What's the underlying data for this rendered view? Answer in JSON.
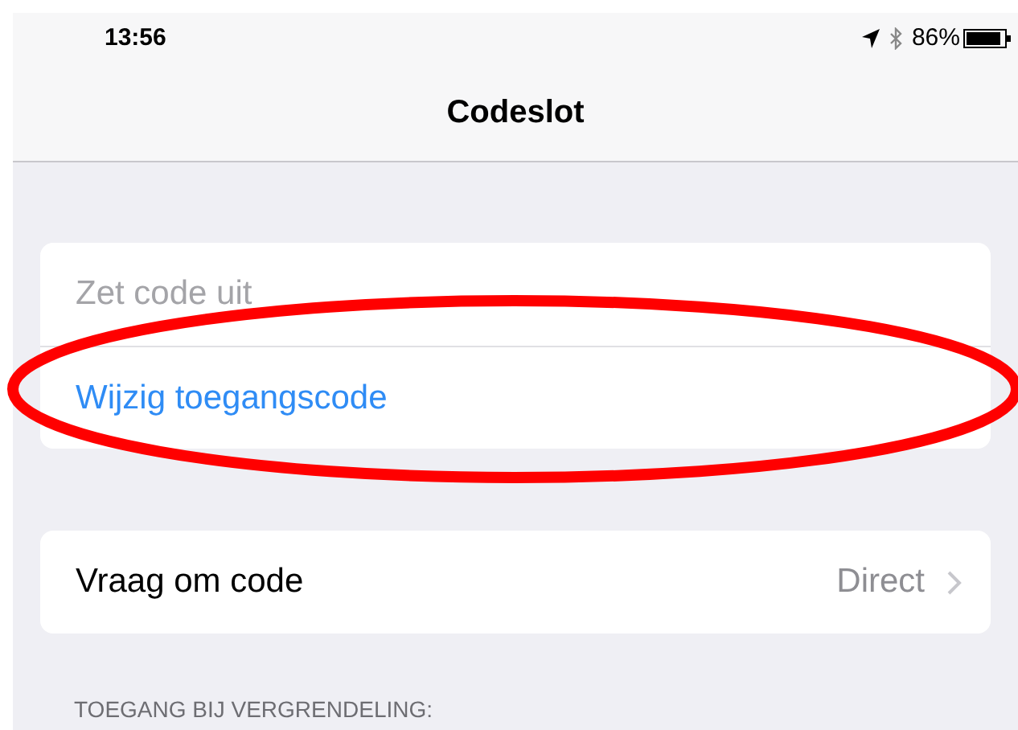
{
  "status_bar": {
    "time": "13:56",
    "battery": "86%"
  },
  "nav_bar": {
    "title": "Codeslot"
  },
  "groups": [
    {
      "rows": [
        {
          "kind": "action",
          "label": "Zet code uit",
          "disabled": true
        },
        {
          "kind": "action",
          "label": "Wijzig toegangscode",
          "disabled": false
        }
      ]
    },
    {
      "rows": [
        {
          "kind": "disclosure",
          "label": "Vraag om code",
          "value": "Direct"
        }
      ]
    }
  ],
  "section_header": "TOEGANG BIJ VERGRENDELING:"
}
